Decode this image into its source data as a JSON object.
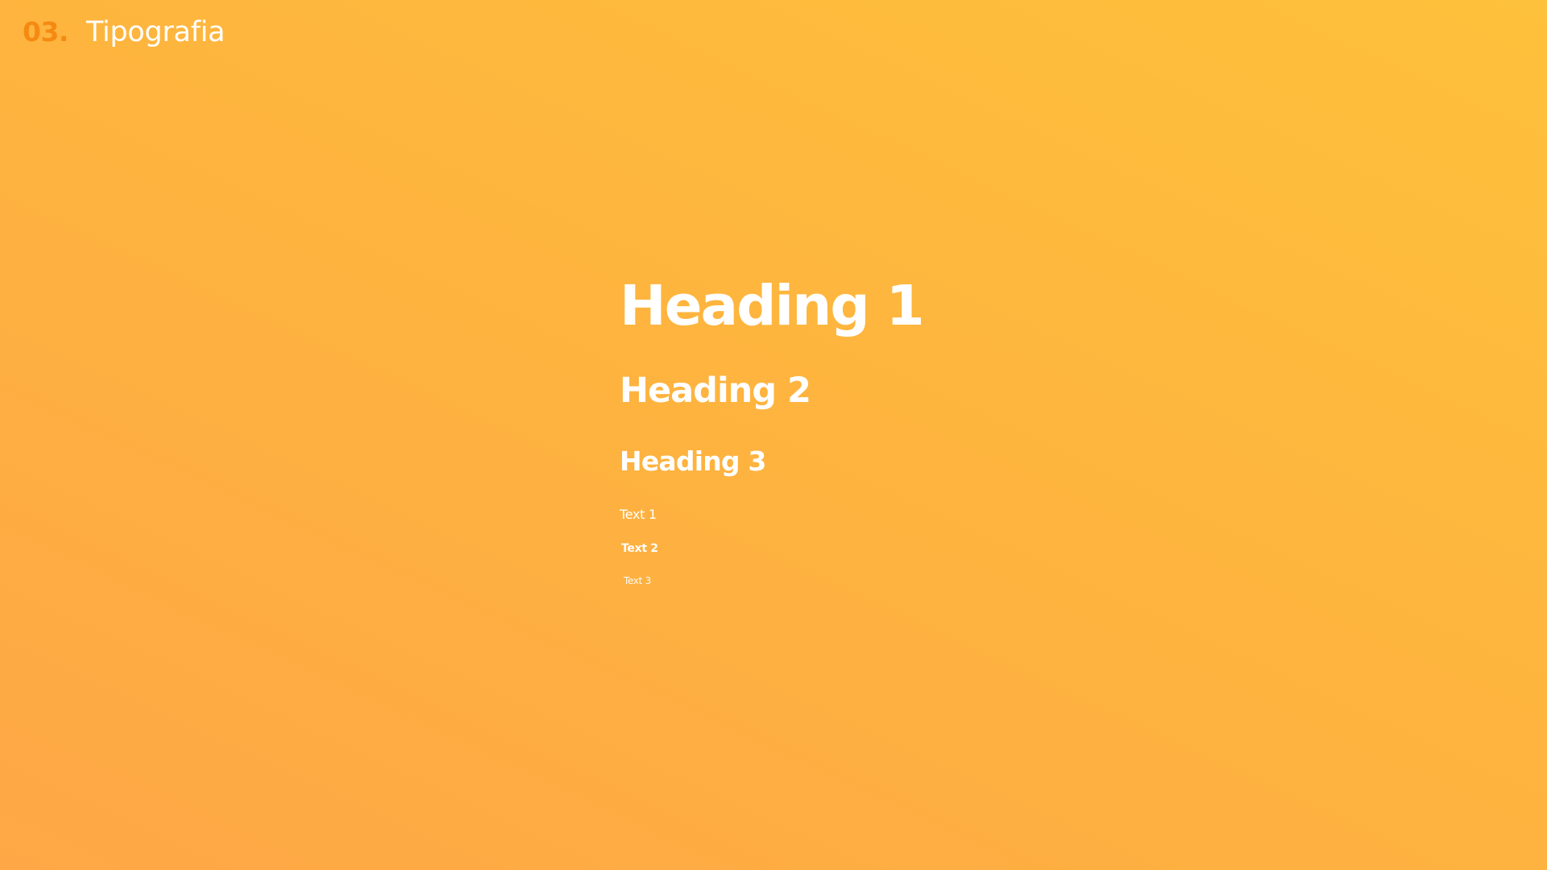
{
  "header": {
    "section_number": "03.",
    "section_title": "Tipografia"
  },
  "typography": {
    "heading1": "Heading 1",
    "heading2": "Heading 2",
    "heading3": "Heading 3",
    "text1": "Text 1",
    "text2": "Text 2",
    "text3": "Text 3"
  },
  "colors": {
    "background_top": "#FEC13B",
    "background_bottom": "#FEA746",
    "accent": "#F58A12",
    "text": "#FFFFFF"
  }
}
